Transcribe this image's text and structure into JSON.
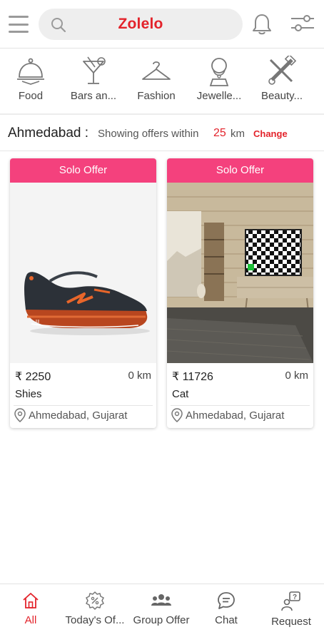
{
  "header": {
    "brand": "Zolelo",
    "menu_icon": "hamburger-menu-icon",
    "search_icon": "search-icon",
    "bell_icon": "bell-icon",
    "filter_icon": "filter-sliders-icon"
  },
  "categories": [
    {
      "label": "Food",
      "icon": "food-cloche-icon"
    },
    {
      "label": "Bars an...",
      "icon": "cocktail-glass-icon"
    },
    {
      "label": "Fashion",
      "icon": "hanger-icon"
    },
    {
      "label": "Jewelle...",
      "icon": "necklace-bust-icon"
    },
    {
      "label": "Beauty...",
      "icon": "beauty-tools-icon"
    }
  ],
  "location": {
    "city": "Ahmedabad :",
    "showing_prefix": "Showing offers within",
    "distance": "25",
    "unit": "km",
    "change_label": "Change"
  },
  "offers": [
    {
      "ribbon": "Solo Offer",
      "price": "₹ 2250",
      "distance": "0 km",
      "title": "Shies",
      "location": "Ahmedabad, Gujarat",
      "image": "sneaker-shoe-photo"
    },
    {
      "ribbon": "Solo Offer",
      "price": "₹ 11726",
      "distance": "0 km",
      "title": "Cat",
      "location": "Ahmedabad, Gujarat",
      "image": "room-with-tv-photo"
    }
  ],
  "bottom_nav": [
    {
      "label": "All",
      "icon": "home-icon",
      "active": true
    },
    {
      "label": "Today's Of...",
      "icon": "percent-badge-icon",
      "active": false
    },
    {
      "label": "Group Offer",
      "icon": "group-people-icon",
      "active": false
    },
    {
      "label": "Chat",
      "icon": "chat-bubble-icon",
      "active": false
    },
    {
      "label": "Request",
      "icon": "request-person-icon",
      "active": false
    }
  ],
  "colors": {
    "brand": "#e3232b",
    "ribbon": "#f4417d",
    "active_nav": "#e3232b"
  }
}
